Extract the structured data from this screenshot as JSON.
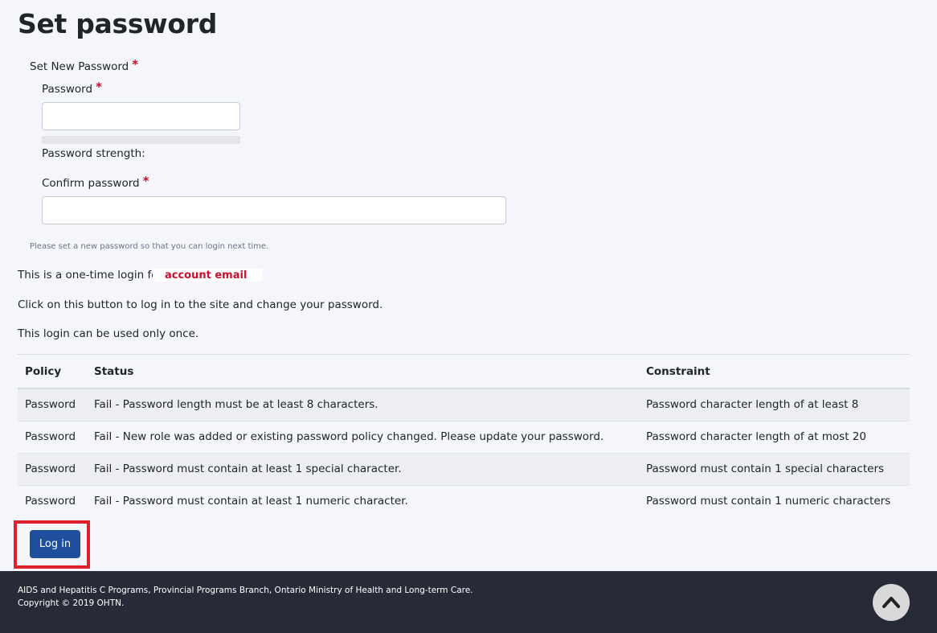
{
  "page_title": "Set password",
  "form": {
    "group_label": "Set New Password",
    "password_label": "Password",
    "password_value": "",
    "strength_label": "Password strength:",
    "confirm_label": "Confirm password",
    "confirm_value": "",
    "required_marker": "*",
    "hint": "Please set a new password so that you can login next time."
  },
  "messages": {
    "one_time_prefix": "This is a one-time login for",
    "account_email": "account email",
    "click_info": "Click on this button to log in to the site and change your password.",
    "once_info": "This login can be used only once."
  },
  "policy_table": {
    "headers": [
      "Policy",
      "Status",
      "Constraint"
    ],
    "rows": [
      [
        "Password",
        "Fail - Password length must be at least 8 characters.",
        "Password character length of at least 8"
      ],
      [
        "Password",
        "Fail - New role was added or existing password policy changed. Please update your password.",
        "Password character length of at most 20"
      ],
      [
        "Password",
        "Fail - Password must contain at least 1 special character.",
        "Password must contain 1 special characters"
      ],
      [
        "Password",
        "Fail - Password must contain at least 1 numeric character.",
        "Password must contain 1 numeric characters"
      ]
    ]
  },
  "login_button": "Log in",
  "footer": {
    "line1": "AIDS and Hepatitis C Programs, Provincial Programs Branch, Ontario Ministry of Health and Long-term Care.",
    "line2": "Copyright © 2019 OHTN.",
    "scroll_top_icon": "chevron-up-icon"
  },
  "colors": {
    "required": "#c8102e",
    "button": "#1f4f9c",
    "footer_bg": "#272b37",
    "highlight_frame": "#e0202a"
  }
}
